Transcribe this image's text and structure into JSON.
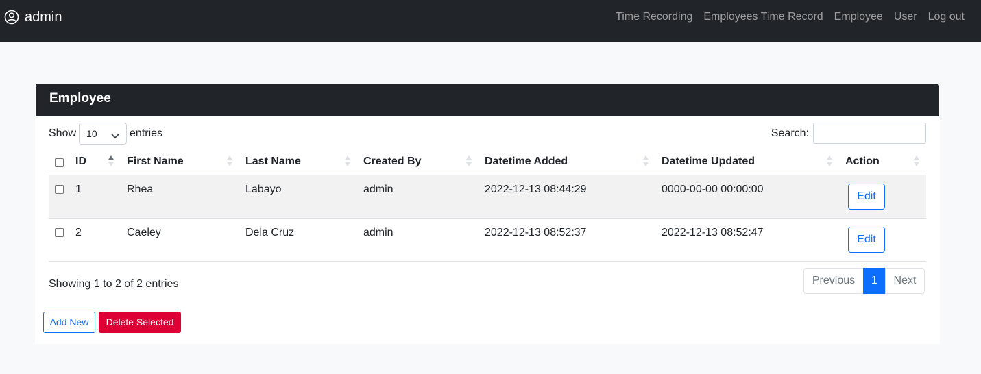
{
  "navbar": {
    "brand_icon": "user-circle-icon",
    "brand_name": "admin",
    "links": [
      "Time Recording",
      "Employees Time Record",
      "Employee",
      "User",
      "Log out"
    ]
  },
  "card": {
    "title": "Employee",
    "show_label": "Show",
    "page_size": "10",
    "entries_label": "entries",
    "search_label": "Search:",
    "search_value": ""
  },
  "table": {
    "headers": [
      "ID",
      "First Name",
      "Last Name",
      "Created By",
      "Datetime Added",
      "Datetime Updated",
      "Action"
    ],
    "rows": [
      {
        "id": "1",
        "first": "Rhea",
        "last": "Labayo",
        "created_by": "admin",
        "added": "2022-12-13 08:44:29",
        "updated": "0000-00-00 00:00:00",
        "action": "Edit"
      },
      {
        "id": "2",
        "first": "Caeley",
        "last": "Dela Cruz",
        "created_by": "admin",
        "added": "2022-12-13 08:52:37",
        "updated": "2022-12-13 08:52:47",
        "action": "Edit"
      }
    ]
  },
  "footer": {
    "info": "Showing 1 to 2 of 2 entries",
    "prev": "Previous",
    "current_page": "1",
    "next": "Next",
    "add_new": "Add New",
    "delete_selected": "Delete Selected"
  },
  "colors": {
    "navbar_bg": "#212529",
    "primary": "#0d6efd",
    "danger": "#dc0035",
    "page_bg": "#f8f9fa"
  }
}
